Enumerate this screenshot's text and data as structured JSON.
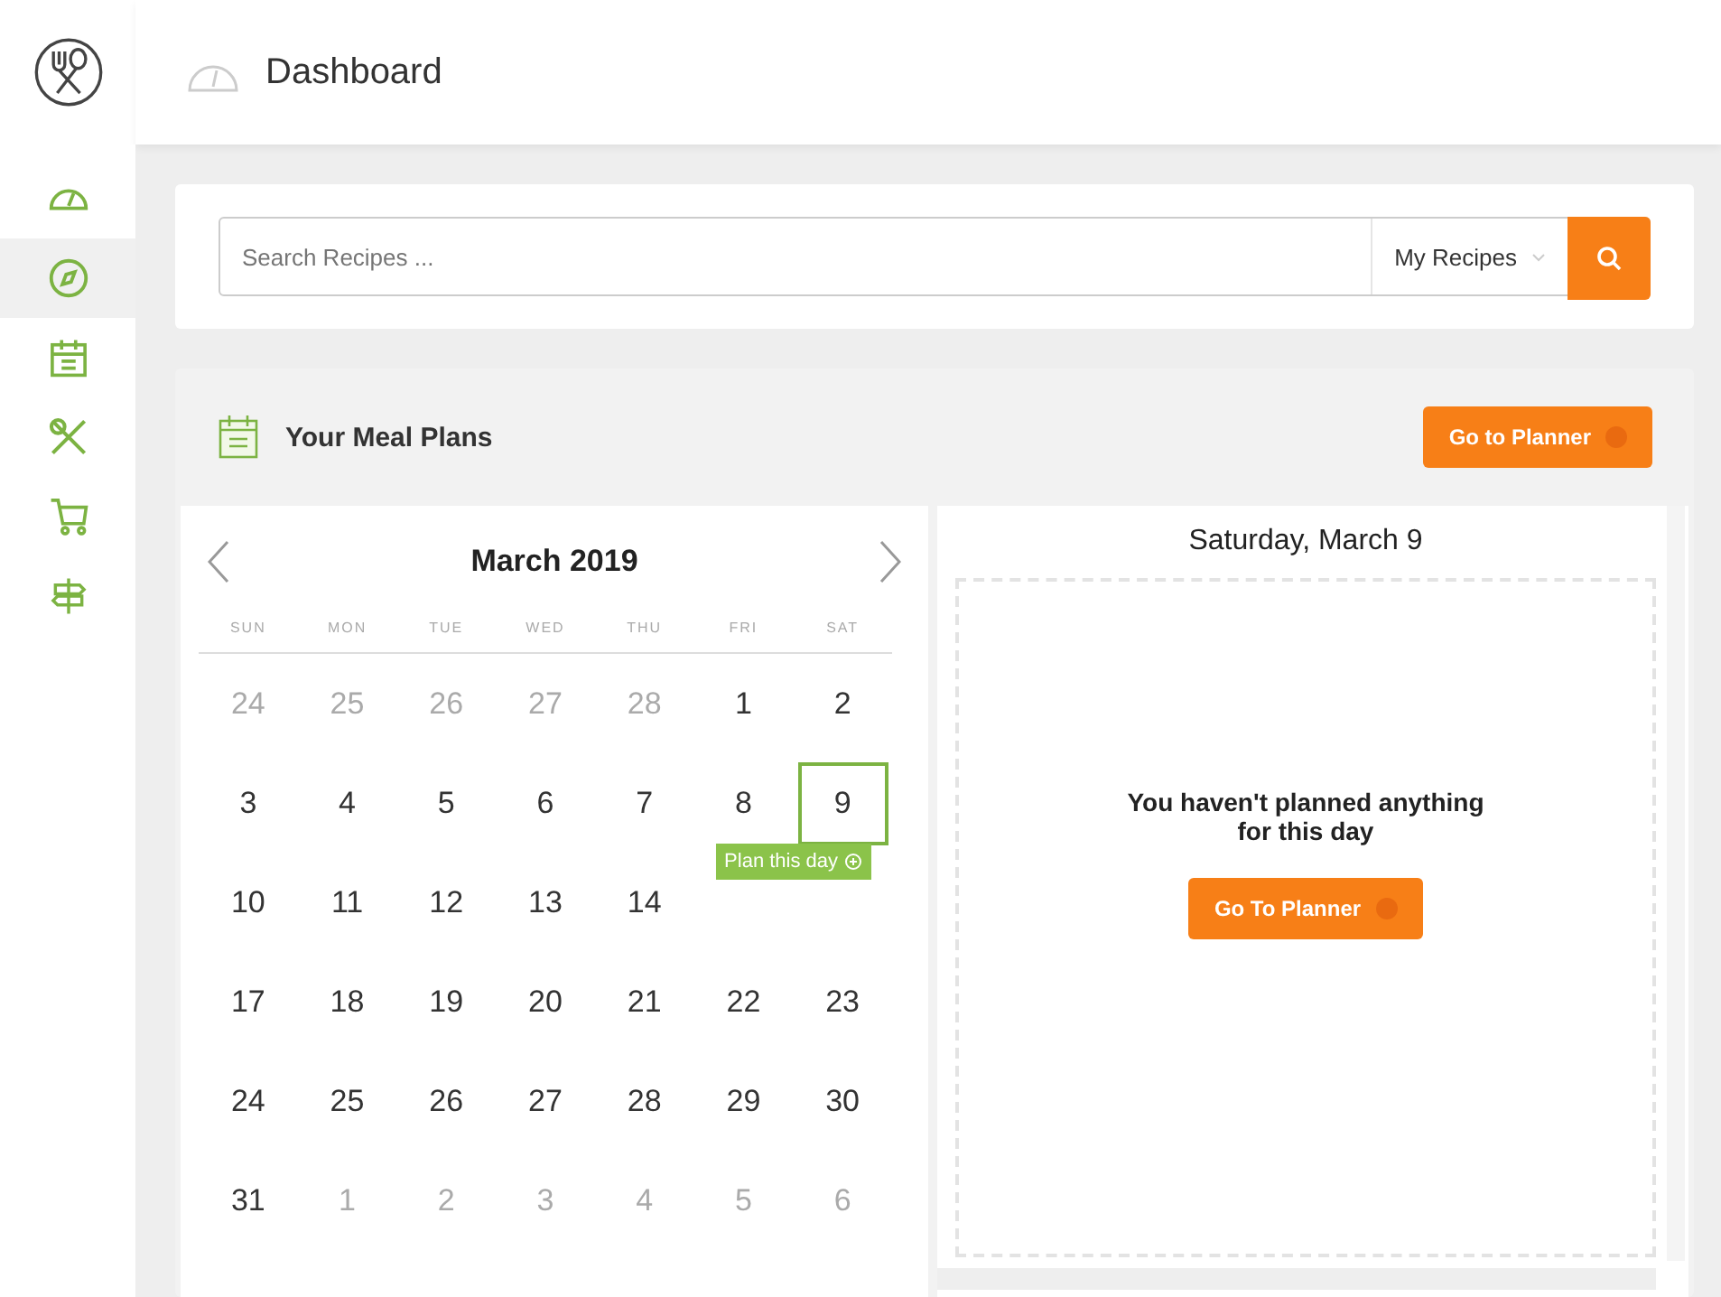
{
  "header": {
    "title": "Dashboard"
  },
  "sidebar": {
    "items": [
      {
        "selected": false
      },
      {
        "selected": true
      },
      {
        "selected": false
      },
      {
        "selected": false
      },
      {
        "selected": false
      },
      {
        "selected": false
      }
    ]
  },
  "search": {
    "placeholder": "Search Recipes ...",
    "scope": "My Recipes"
  },
  "meal_plans": {
    "title": "Your Meal Plans",
    "planner_button": "Go to Planner",
    "calendar": {
      "month": "March 2019",
      "weekdays": [
        "SUN",
        "MON",
        "TUE",
        "WED",
        "THU",
        "FRI",
        "SAT"
      ],
      "weeks": [
        [
          {
            "day": "24",
            "muted": true,
            "selected": false
          },
          {
            "day": "25",
            "muted": true,
            "selected": false
          },
          {
            "day": "26",
            "muted": true,
            "selected": false
          },
          {
            "day": "27",
            "muted": true,
            "selected": false
          },
          {
            "day": "28",
            "muted": true,
            "selected": false
          },
          {
            "day": "1",
            "muted": false,
            "selected": false
          },
          {
            "day": "2",
            "muted": false,
            "selected": false
          }
        ],
        [
          {
            "day": "3",
            "muted": false,
            "selected": false
          },
          {
            "day": "4",
            "muted": false,
            "selected": false
          },
          {
            "day": "5",
            "muted": false,
            "selected": false
          },
          {
            "day": "6",
            "muted": false,
            "selected": false
          },
          {
            "day": "7",
            "muted": false,
            "selected": false
          },
          {
            "day": "8",
            "muted": false,
            "selected": false
          },
          {
            "day": "9",
            "muted": false,
            "selected": true
          }
        ],
        [
          {
            "day": "10",
            "muted": false,
            "selected": false
          },
          {
            "day": "11",
            "muted": false,
            "selected": false
          },
          {
            "day": "12",
            "muted": false,
            "selected": false
          },
          {
            "day": "13",
            "muted": false,
            "selected": false
          },
          {
            "day": "14",
            "muted": false,
            "selected": false
          }
        ],
        [
          {
            "day": "17",
            "muted": false,
            "selected": false
          },
          {
            "day": "18",
            "muted": false,
            "selected": false
          },
          {
            "day": "19",
            "muted": false,
            "selected": false
          },
          {
            "day": "20",
            "muted": false,
            "selected": false
          },
          {
            "day": "21",
            "muted": false,
            "selected": false
          },
          {
            "day": "22",
            "muted": false,
            "selected": false
          },
          {
            "day": "23",
            "muted": false,
            "selected": false
          }
        ],
        [
          {
            "day": "24",
            "muted": false,
            "selected": false
          },
          {
            "day": "25",
            "muted": false,
            "selected": false
          },
          {
            "day": "26",
            "muted": false,
            "selected": false
          },
          {
            "day": "27",
            "muted": false,
            "selected": false
          },
          {
            "day": "28",
            "muted": false,
            "selected": false
          },
          {
            "day": "29",
            "muted": false,
            "selected": false
          },
          {
            "day": "30",
            "muted": false,
            "selected": false
          }
        ],
        [
          {
            "day": "31",
            "muted": false,
            "selected": false
          },
          {
            "day": "1",
            "muted": true,
            "selected": false
          },
          {
            "day": "2",
            "muted": true,
            "selected": false
          },
          {
            "day": "3",
            "muted": true,
            "selected": false
          },
          {
            "day": "4",
            "muted": true,
            "selected": false
          },
          {
            "day": "5",
            "muted": true,
            "selected": false
          },
          {
            "day": "6",
            "muted": true,
            "selected": false
          }
        ]
      ],
      "tooltip": "Plan this day"
    },
    "day_panel": {
      "title": "Saturday, March 9",
      "message": "You haven't planned anything for this day",
      "button": "Go To Planner"
    }
  }
}
